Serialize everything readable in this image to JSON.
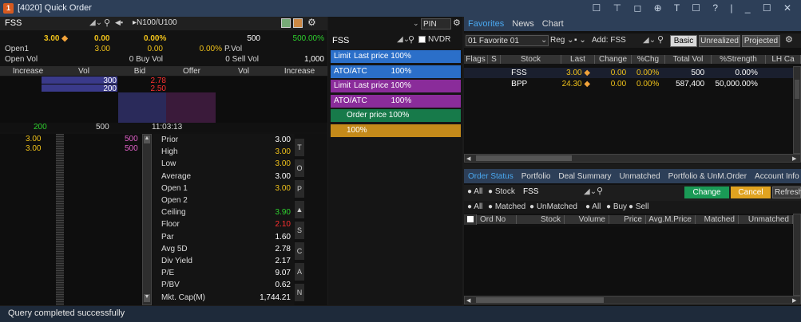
{
  "window": {
    "logo": "1",
    "title": "[4020] Quick Order",
    "controls": "☐ ⊤ ◻ ⊕ T ☐ ? | _ ☐ ✕"
  },
  "quote": {
    "symbol": "FSS",
    "board": "N100/U100",
    "last": "3.00",
    "change": "0.00",
    "pct_change": "0.00%",
    "volume": "500",
    "pct_volume": "500.00%",
    "open1_label": "Open1",
    "open1_value": "3.00",
    "open1_change": "0.00",
    "open1_pct": "0.00%",
    "pvol_label": "P.Vol",
    "open_vol_label": "Open Vol",
    "buy_vol": "0 Buy Vol",
    "sell_vol": "0 Sell Vol",
    "open_vol_value": "1,000"
  },
  "bidoffer": {
    "headers": [
      "Increase",
      "Vol",
      "Bid",
      "Offer",
      "Vol",
      "Increase"
    ],
    "bids": [
      {
        "vol": "300",
        "price": "2.78"
      },
      {
        "vol": "200",
        "price": "2.50"
      }
    ],
    "footer_left": "200",
    "footer_vol": "500",
    "footer_time": "11:03:13"
  },
  "ticks": [
    {
      "price": "3.00",
      "vol": "500"
    },
    {
      "price": "3.00",
      "vol": "500"
    }
  ],
  "info": [
    {
      "label": "Prior",
      "value": "3.00",
      "color": "#ffffff"
    },
    {
      "label": "High",
      "value": "3.00",
      "color": "#f0c21a"
    },
    {
      "label": "Low",
      "value": "3.00",
      "color": "#f0c21a"
    },
    {
      "label": "Average",
      "value": "3.00",
      "color": "#ffffff"
    },
    {
      "label": "Open 1",
      "value": "3.00",
      "color": "#f0c21a"
    },
    {
      "label": "Open 2",
      "value": "",
      "color": "#ffffff"
    },
    {
      "label": "Ceiling",
      "value": "3.90",
      "color": "#2ed02e"
    },
    {
      "label": "Floor",
      "value": "2.10",
      "color": "#ff3030"
    },
    {
      "label": "Par",
      "value": "1.60",
      "color": "#ffffff"
    },
    {
      "label": "Avg 5D",
      "value": "2.78",
      "color": "#ffffff"
    },
    {
      "label": "Div Yield",
      "value": "2.17",
      "color": "#ffffff"
    },
    {
      "label": "P/E",
      "value": "9.07",
      "color": "#ffffff"
    },
    {
      "label": "P/BV",
      "value": "0.62",
      "color": "#ffffff"
    },
    {
      "label": "Mkt. Cap(M)",
      "value": "1,744.21",
      "color": "#ffffff"
    }
  ],
  "side_tabs": [
    "T",
    "O",
    "P",
    "▲",
    "S",
    "C",
    "A",
    "N"
  ],
  "order_panel": {
    "pin": "PIN",
    "symbol": "FSS",
    "nvdr": "NVDR",
    "buttons": [
      {
        "left": "Limit",
        "right": "Last price 100%",
        "color": "#2b6fc9"
      },
      {
        "left": "ATO/ATC",
        "right": "100%",
        "color": "#2b6fc9"
      },
      {
        "left": "Limit",
        "right": "Last price 100%",
        "color": "#8a2c9a"
      },
      {
        "left": "ATO/ATC",
        "right": "100%",
        "color": "#8a2c9a"
      },
      {
        "left": "",
        "right": "Order price 100%",
        "color": "#177a4a"
      },
      {
        "left": "",
        "right": "100%",
        "color": "#c48a1a"
      }
    ]
  },
  "favorites": {
    "tabs": [
      "Favorites",
      "News",
      "Chart"
    ],
    "list_name": "01  Favorite 01",
    "reg": "Reg",
    "add_label": "Add: FSS",
    "view_buttons": [
      "Basic",
      "Unrealized",
      "Projected"
    ],
    "columns": [
      "Flags",
      "S",
      "Stock",
      "Last",
      "Change",
      "%Chg",
      "Total Vol",
      "%Strength",
      "LH Ca"
    ],
    "rows": [
      {
        "stock": "FSS",
        "last": "3.00",
        "change": "0.00",
        "pchg": "0.00%",
        "vol": "500",
        "strength": "0.00%"
      },
      {
        "stock": "BPP",
        "last": "24.30",
        "change": "0.00",
        "pchg": "0.00%",
        "vol": "587,400",
        "strength": "50,000.00%"
      }
    ]
  },
  "orders": {
    "tabs": [
      "Order Status",
      "Portfolio",
      "Deal Summary",
      "Unmatched",
      "Portfolio & UnM.Order",
      "Account Info"
    ],
    "filter1": [
      "All",
      "Stock"
    ],
    "stock": "FSS",
    "change_btn": "Change",
    "cancel_btn": "Cancel",
    "refresh_btn": "Refresh",
    "filter2": [
      "All",
      "Matched",
      "UnMatched"
    ],
    "filter3": [
      "All",
      "Buy",
      "Sell"
    ],
    "columns": [
      "Ord No",
      "Stock",
      "Volume",
      "Price",
      "Avg.M.Price",
      "Matched",
      "Unmatched"
    ]
  },
  "status": "Query completed successfully"
}
